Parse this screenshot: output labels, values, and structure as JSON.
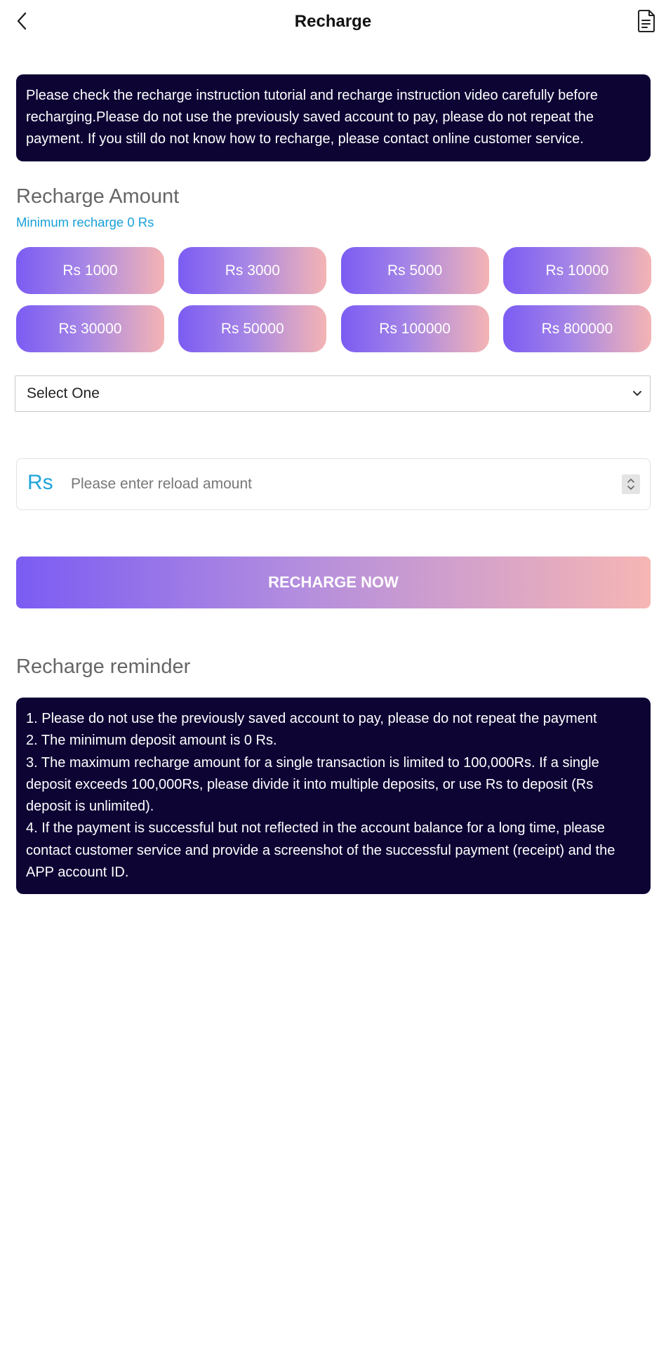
{
  "header": {
    "title": "Recharge",
    "back_icon": "chevron-left-icon",
    "record_icon": "document-icon"
  },
  "notice": {
    "text": "Please check the recharge instruction tutorial and recharge instruction video carefully before recharging.Please do not use the previously saved account to pay, please do not repeat the payment. If you still do not know how to recharge, please contact online customer service."
  },
  "recharge_amount": {
    "title": "Recharge Amount",
    "minimum": "Minimum recharge 0 Rs",
    "options": [
      "Rs 1000",
      "Rs 3000",
      "Rs 5000",
      "Rs 10000",
      "Rs 30000",
      "Rs 50000",
      "Rs 100000",
      "Rs 800000"
    ]
  },
  "channel_select": {
    "selected": "Select One"
  },
  "amount_input": {
    "prefix": "Rs",
    "placeholder": "Please enter reload amount"
  },
  "recharge_button": {
    "label": "RECHARGE NOW"
  },
  "reminder": {
    "title": "Recharge reminder",
    "items": [
      "1. Please do not use the previously saved account to pay, please do not repeat the payment",
      "2. The minimum deposit amount is 0 Rs.",
      "3. The maximum recharge amount for a single transaction is limited to 100,000Rs. If a single deposit exceeds 100,000Rs, please divide it into multiple deposits, or use Rs to deposit (Rs deposit is unlimited).",
      "4. If the payment is successful but not reflected in the account balance for a long time, please contact customer service and provide a screenshot of the successful payment (receipt) and the APP account ID."
    ]
  },
  "colors": {
    "notice_background": "#0d0434",
    "accent_blue": "#18a0d8",
    "gradient_start": "#7b5cf3",
    "gradient_end": "#f4b4b4"
  }
}
